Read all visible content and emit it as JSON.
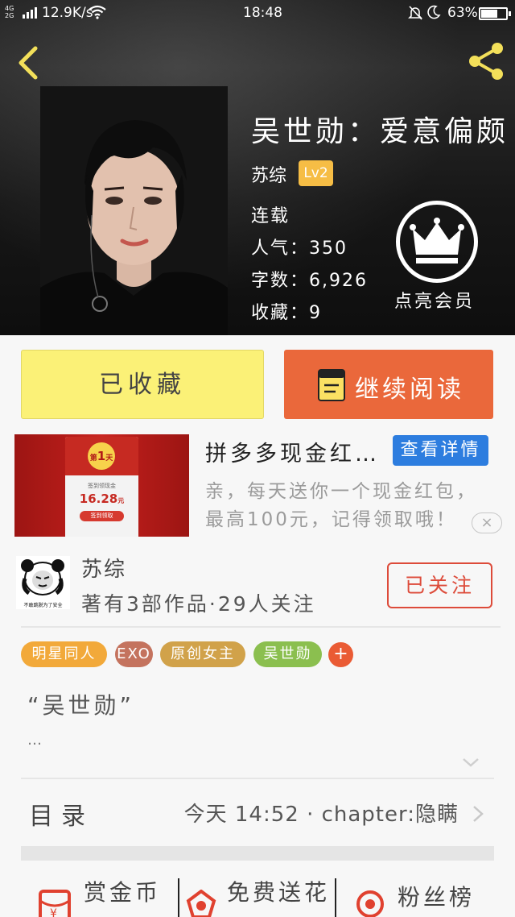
{
  "status_bar": {
    "network": "4G\n2G",
    "speed": "12.9K/s",
    "time": "18:48",
    "battery": "63%"
  },
  "book": {
    "title": "吴世勋：爱意偏颇",
    "author": "苏综",
    "level": "Lv2",
    "status": "连载",
    "popularity": "人气：350",
    "word_count": "字数：6,926",
    "favorites": "收藏：9",
    "vip_label": "点亮会员"
  },
  "actions": {
    "favorited": "已收藏",
    "continue_reading": "继续阅读"
  },
  "ad": {
    "title": "拼多多现金红…",
    "detail_button": "查看详情",
    "desc_line1": "亲，每天送你一个现金红包，",
    "desc_line2": "最高100元，记得领取哦！",
    "close": "×",
    "card_day_prefix": "第",
    "card_day": "1",
    "card_day_suffix": "天",
    "card_caption": "签到领现金",
    "card_amount": "16.28",
    "card_unit": "元",
    "card_button": "签到领取",
    "accent_color": "#c92722"
  },
  "author_section": {
    "name": "苏综",
    "info": "著有3部作品·29人关注",
    "follow_button": "已关注",
    "avatar_caption": "不敢跳脱为了安全"
  },
  "tags": [
    {
      "label": "明星同人",
      "color": "#f2a93a"
    },
    {
      "label": "EXO",
      "color": "#c4735e"
    },
    {
      "label": "原创女主",
      "color": "#d1a24a"
    },
    {
      "label": "吴世勋",
      "color": "#8bbf4f"
    }
  ],
  "tag_add": "+",
  "intro": {
    "quote": "“吴世勋”",
    "ellipsis": "…"
  },
  "toc": {
    "label": "目录",
    "latest": "今天 14:52 · chapter:隐瞒"
  },
  "bottom_nav": [
    {
      "label": "赏金币",
      "icon": "red-envelope-icon"
    },
    {
      "label": "免费送花",
      "icon": "flower-icon"
    },
    {
      "label": "粉丝榜",
      "icon": "medal-icon"
    }
  ]
}
